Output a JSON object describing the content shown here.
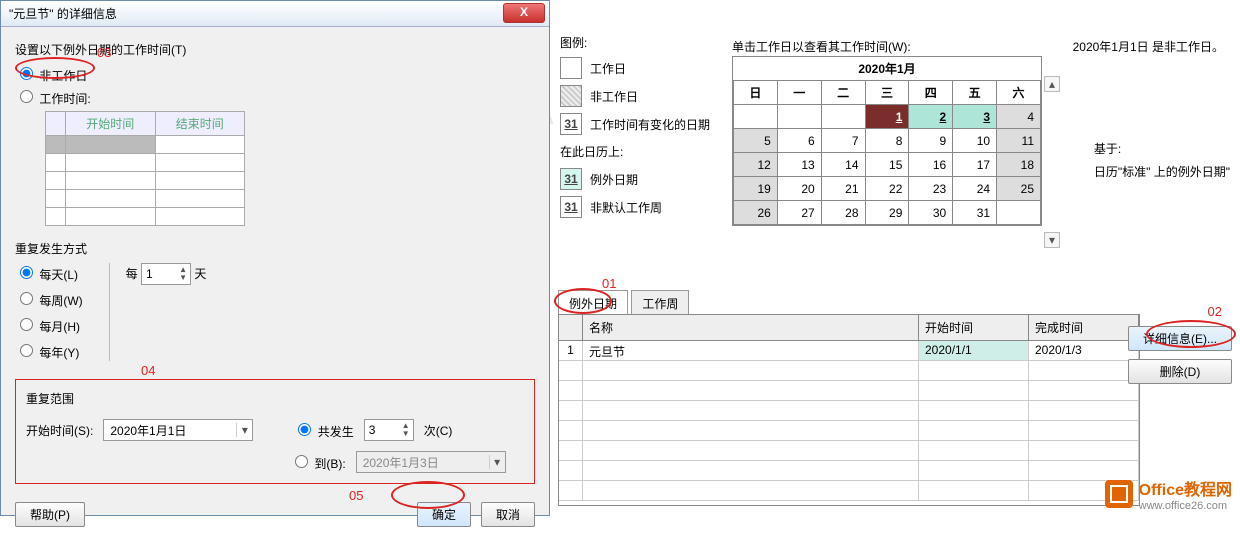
{
  "dialog": {
    "title": "\"元旦节\" 的详细信息",
    "set_label": "设置以下例外日期的工作时间(T)",
    "opt_nonwork": "非工作日",
    "opt_work": "工作时间:",
    "grid": {
      "start_hdr": "开始时间",
      "end_hdr": "结束时间"
    },
    "recur_label": "重复发生方式",
    "daily": "每天(L)",
    "weekly": "每周(W)",
    "monthly": "每月(H)",
    "yearly": "每年(Y)",
    "every": "每",
    "days": "天",
    "every_value": "1",
    "range_label": "重复范围",
    "start_time_label": "开始时间(S):",
    "start_time_value": "2020年1月1日",
    "occurs_label": "共发生",
    "occurs_value": "3",
    "times": "次(C)",
    "until_label": "到(B):",
    "until_value": "2020年1月3日",
    "help": "帮助(P)",
    "ok": "确定",
    "cancel": "取消",
    "marks": {
      "m03": "03",
      "m04": "04",
      "m05": "05"
    }
  },
  "right": {
    "legend_label": "图例:",
    "workday": "工作日",
    "nonworkday": "非工作日",
    "editedwork": "工作时间有变化的日期",
    "oncal": "在此日历上:",
    "exception": "例外日期",
    "nondefweek": "非默认工作周",
    "legend_num": "31",
    "cal_hint": "单击工作日以查看其工作时间(W):",
    "cal_title": "2020年1月",
    "weekdays": [
      "日",
      "一",
      "二",
      "三",
      "四",
      "五",
      "六"
    ],
    "top_right": "2020年1月1日 是非工作日。",
    "base_label": "基于:",
    "base_text": "日历\"标准\" 上的例外日期\"",
    "tabs": {
      "exceptions": "例外日期",
      "workweek": "工作周"
    },
    "grid": {
      "name": "名称",
      "start": "开始时间",
      "end": "完成时间",
      "rownum": "1",
      "row_name": "元旦节",
      "row_start": "2020/1/1",
      "row_end": "2020/1/3"
    },
    "detail_btn": "详细信息(E)...",
    "delete_btn": "删除(D)",
    "marks": {
      "m01": "01",
      "m02": "02"
    }
  },
  "logo": {
    "t1": "Office教程网",
    "t2": "www.office26.com"
  }
}
